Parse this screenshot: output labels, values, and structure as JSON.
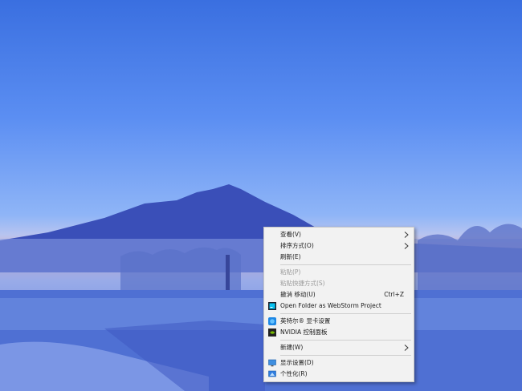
{
  "desktop": {
    "wallpaper": "mountain-lake-dawn"
  },
  "context_menu": {
    "items": [
      {
        "label": "查看(V)",
        "has_submenu": true
      },
      {
        "label": "排序方式(O)",
        "has_submenu": true
      },
      {
        "label": "刷新(E)"
      },
      {
        "label": "粘贴(P)",
        "disabled": true
      },
      {
        "label": "粘贴快捷方式(S)",
        "disabled": true
      },
      {
        "label": "撤消 移动(U)",
        "shortcut": "Ctrl+Z"
      },
      {
        "label": "Open Folder as WebStorm Project",
        "icon": "webstorm-icon"
      },
      {
        "label": "英特尔® 显卡设置",
        "icon": "intel-graphics-icon"
      },
      {
        "label": "NVIDIA 控制面板",
        "icon": "nvidia-icon"
      },
      {
        "label": "新建(W)",
        "has_submenu": true
      },
      {
        "label": "显示设置(D)",
        "icon": "display-settings-icon"
      },
      {
        "label": "个性化(R)",
        "icon": "personalize-icon"
      }
    ]
  },
  "colors": {
    "menu_bg": "#f2f2f2",
    "menu_border": "#c8c8c8",
    "disabled_text": "#9a9a9a"
  }
}
